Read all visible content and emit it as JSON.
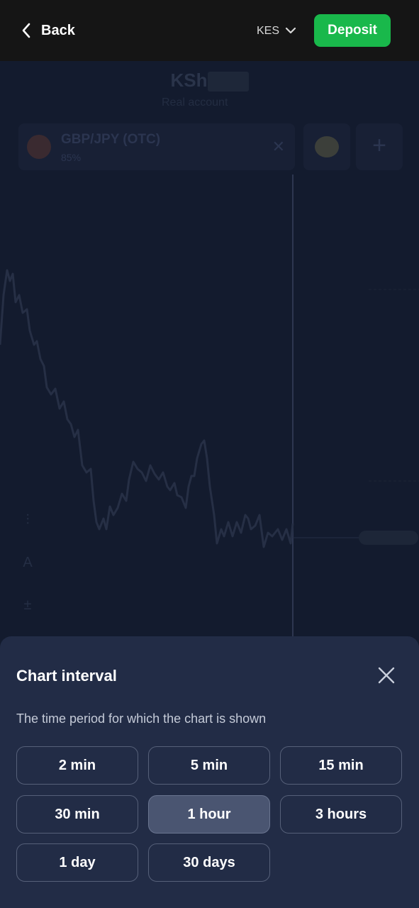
{
  "topbar": {
    "back_label": "Back",
    "currency": "KES",
    "deposit_label": "Deposit"
  },
  "background": {
    "balance_prefix": "KSh",
    "account_label": "Real account",
    "asset_name": "GBP/JPY (OTC)",
    "asset_payout": "85%"
  },
  "sheet": {
    "title": "Chart interval",
    "subtitle": "The time period for which the chart is shown",
    "options": [
      {
        "label": "2 min",
        "selected": false
      },
      {
        "label": "5 min",
        "selected": false
      },
      {
        "label": "15 min",
        "selected": false
      },
      {
        "label": "30 min",
        "selected": false
      },
      {
        "label": "1 hour",
        "selected": true
      },
      {
        "label": "3 hours",
        "selected": false
      },
      {
        "label": "1 day",
        "selected": false
      },
      {
        "label": "30 days",
        "selected": false
      }
    ]
  },
  "colors": {
    "deposit_green": "#19b84b",
    "sheet_bg": "#222c46",
    "selected_bg": "#4a5571"
  }
}
